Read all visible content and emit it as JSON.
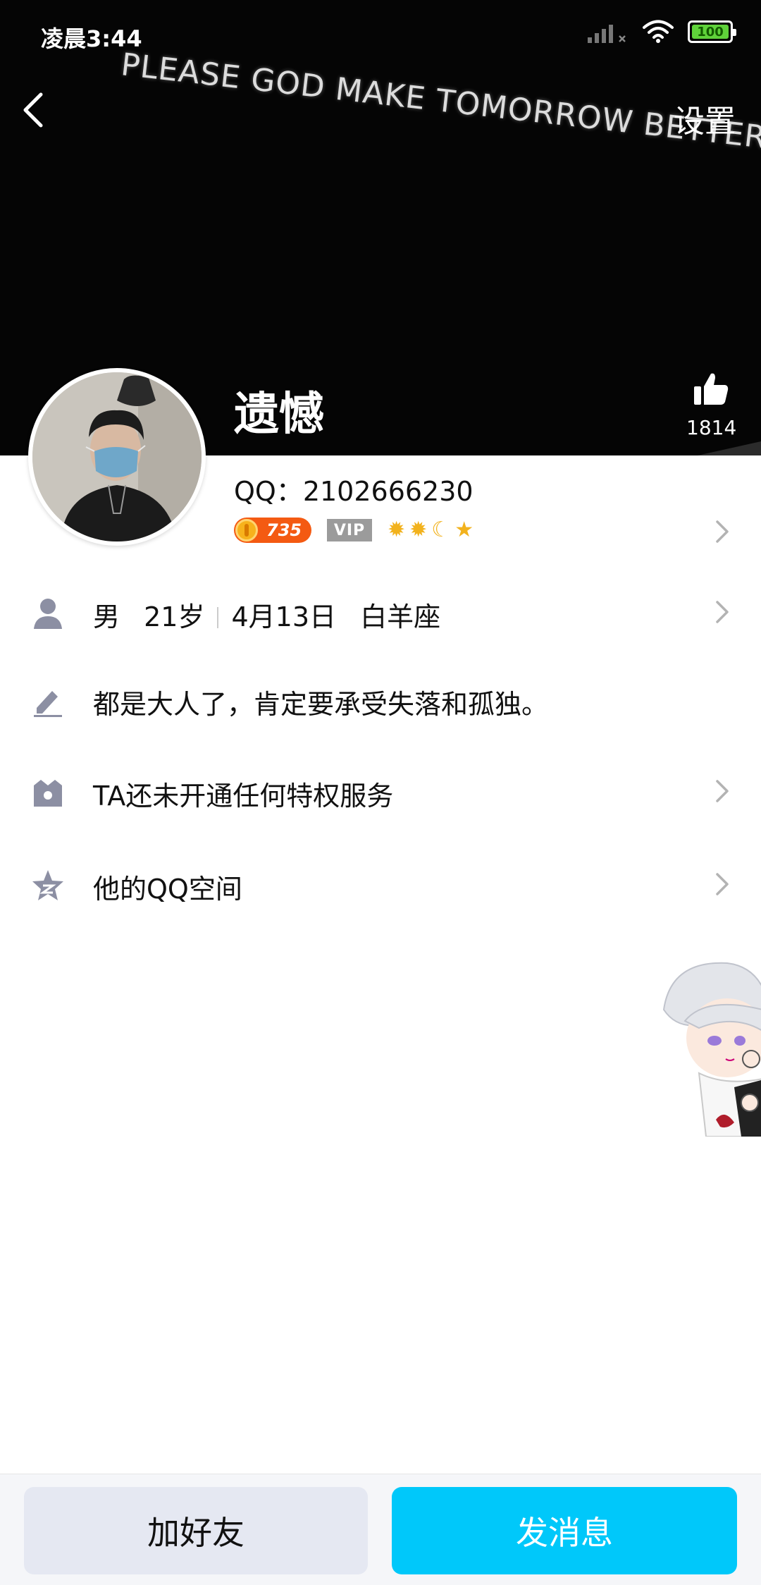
{
  "status_bar": {
    "time": "凌晨3:44",
    "battery": "100"
  },
  "cover": {
    "banner_text": "PLEASE GOD MAKE TOMORROW BETTER"
  },
  "nav": {
    "settings_label": "设置"
  },
  "profile": {
    "name": "遗憾",
    "likes": "1814",
    "qq_line": "QQ：2102666230",
    "coin_value": "735",
    "vip_label": "VIP",
    "level_icons": [
      "sun-icon",
      "sun-icon",
      "moon-icon",
      "star-icon"
    ]
  },
  "details": {
    "gender": "男",
    "age": "21岁",
    "birthday": "4月13日",
    "zodiac": "白羊座"
  },
  "signature": "都是大人了，肯定要承受失落和孤独。",
  "privilege": "TA还未开通任何特权服务",
  "qzone": "他的QQ空间",
  "actions": {
    "add_friend": "加好友",
    "send_message": "发消息"
  },
  "colors": {
    "primary": "#00c8fa",
    "secondary_button": "#e5e8f2",
    "icon": "#8c8fa3"
  }
}
